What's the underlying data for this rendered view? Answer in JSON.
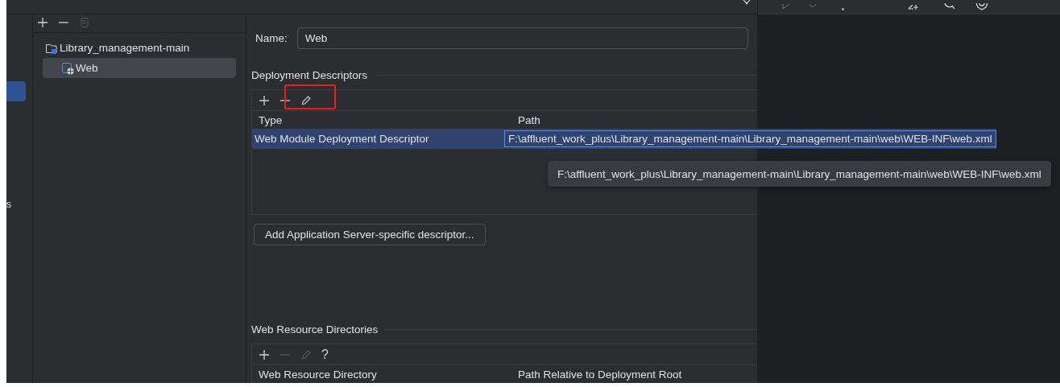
{
  "sidebar": {
    "items": [
      {
        "selected": true
      },
      {
        "label": "s",
        "selected": false
      }
    ]
  },
  "tree": {
    "tools": [
      {
        "kind": "add",
        "disabled": false
      },
      {
        "kind": "remove",
        "disabled": false
      },
      {
        "kind": "copy",
        "disabled": true
      }
    ],
    "items": [
      {
        "label": "Library_management-main",
        "selected": false,
        "children": [
          {
            "label": "Web",
            "selected": true
          }
        ]
      }
    ]
  },
  "details": {
    "name_label": "Name:",
    "name_value": "Web",
    "deployment_descriptors": {
      "title": "Deployment Descriptors",
      "tools": [
        {
          "kind": "add",
          "disabled": false,
          "highlighted": false
        },
        {
          "kind": "remove",
          "disabled": false,
          "highlighted": false
        },
        {
          "kind": "edit",
          "disabled": false,
          "highlighted": true
        }
      ],
      "columns": [
        "Type",
        "Path"
      ],
      "rows": [
        {
          "type": "Web Module Deployment Descriptor",
          "path": "F:\\affluent_work_plus\\Library_management-main\\Library_management-main\\web\\WEB-INF\\web.xml",
          "selected": true
        }
      ]
    },
    "add_button": "Add Application Server-specific descriptor...",
    "tooltip": "F:\\affluent_work_plus\\Library_management-main\\Library_management-main\\web\\WEB-INF\\web.xml",
    "web_resource_directories": {
      "title": "Web Resource Directories",
      "tools": [
        {
          "kind": "add",
          "disabled": false,
          "highlighted": false
        },
        {
          "kind": "remove",
          "disabled": true,
          "highlighted": false
        },
        {
          "kind": "edit",
          "disabled": true,
          "highlighted": false
        },
        {
          "kind": "help",
          "label": "?",
          "disabled": false,
          "highlighted": false
        }
      ],
      "columns": [
        "Web Resource Directory",
        "Path Relative to Deployment Root"
      ]
    }
  }
}
